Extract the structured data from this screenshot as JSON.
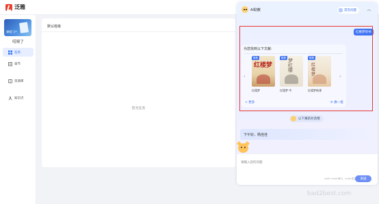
{
  "app": {
    "logo_text": "泛雅"
  },
  "sidebar": {
    "course_cover_text": "课程门户",
    "course_name": "哎呀了",
    "items": [
      {
        "label": "任务",
        "icon": "grid-icon",
        "active": true
      },
      {
        "label": "章节",
        "icon": "chapter-icon",
        "active": false
      },
      {
        "label": "资源库",
        "icon": "library-icon",
        "active": false
      },
      {
        "label": "知识点",
        "icon": "knowledge-icon",
        "active": false
      }
    ]
  },
  "main": {
    "panel_title": "默认班级",
    "empty_text": "暂无任务"
  },
  "ai": {
    "title": "AI助教",
    "question_button": "常见问题",
    "collapse_glyph": "︿",
    "user_message": "红楼梦的书",
    "result_title": "为您找到以下文献:",
    "books": [
      {
        "badge": "推荐",
        "cover_text": "红楼梦",
        "name": "红楼梦"
      },
      {
        "badge": "推荐",
        "cover_text": "梦红楼",
        "name": "红楼梦 中"
      },
      {
        "badge": "推荐",
        "cover_text": "红楼梦",
        "name": "红楼梦新课"
      }
    ],
    "more_label": "< 更多",
    "refresh_label": "换一批",
    "tip_chip": "以下重新对话哦",
    "greeting": "下午好，杨佳佳",
    "input_placeholder": "请输入您的问题",
    "input_hint": "shift+enter换行，enter发送",
    "send_label": "发送"
  },
  "watermark": "bad2best.com",
  "colors": {
    "accent": "#3f73f3",
    "brand_red": "#e8412f",
    "highlight": "#e53935"
  }
}
